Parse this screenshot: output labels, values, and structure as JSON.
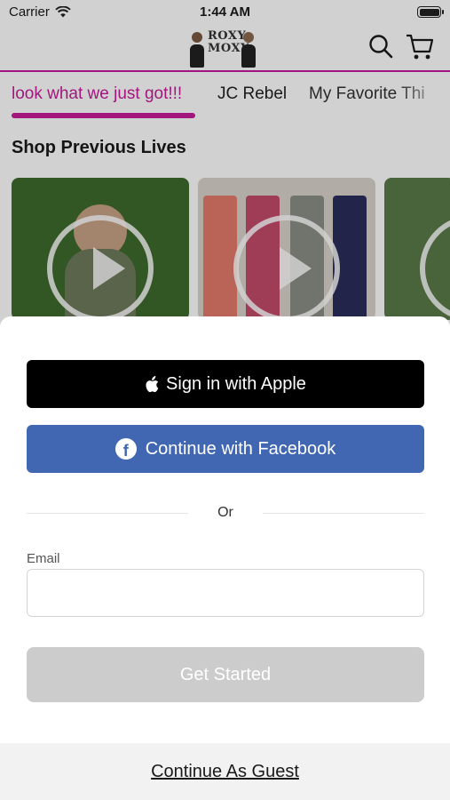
{
  "status_bar": {
    "carrier": "Carrier",
    "time": "1:44 AM"
  },
  "header": {
    "logo_alt": "ROXY MOXY",
    "logo_line1": "ROXY",
    "logo_line2": "MOXY",
    "accent_color": "#c71c9a"
  },
  "tabs": [
    {
      "label": "look what we just got!!!"
    },
    {
      "label": "JC Rebel"
    },
    {
      "label": "My Favorite Thi"
    }
  ],
  "section": {
    "title": "Shop Previous Lives"
  },
  "videos": [
    {
      "icon": "play-icon"
    },
    {
      "icon": "play-icon"
    },
    {
      "icon": "play-icon"
    }
  ],
  "sheet": {
    "apple_label": "Sign in with Apple",
    "facebook_label": "Continue with Facebook",
    "divider_text": "Or",
    "email_label": "Email",
    "email_value": "",
    "email_placeholder": "",
    "submit_label": "Get Started",
    "guest_label": "Continue As Guest",
    "facebook_color": "#4267b2"
  }
}
